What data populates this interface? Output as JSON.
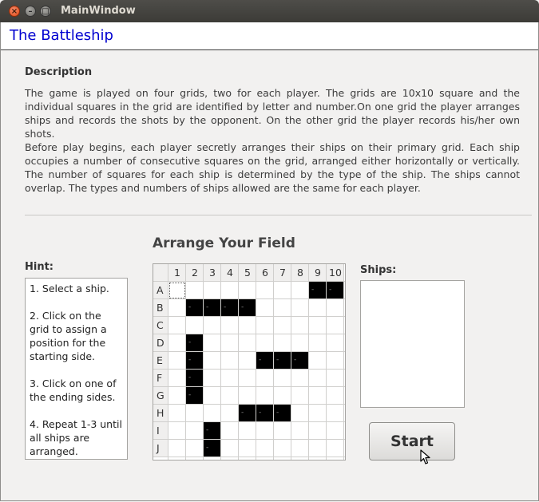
{
  "window": {
    "title": "MainWindow"
  },
  "app": {
    "title": "The Battleship"
  },
  "description": {
    "heading": "Description",
    "para1": "The game is played on four grids, two for each player. The grids are 10x10 square and the individual squares in the grid are identified by letter and number.On one grid the player arranges ships and records the shots by the opponent. On the other grid the player records his/her own shots.",
    "para2": "Before play begins, each player secretly arranges their ships on their primary grid. Each ship occupies a number of consecutive squares on the grid, arranged either horizontally or vertically. The number of squares for each ship is determined by the type of the ship. The ships cannot overlap. The types and numbers of ships allowed are the same for each player."
  },
  "field": {
    "heading": "Arrange Your Field"
  },
  "hint": {
    "label": "Hint:",
    "steps": [
      "1. Select a ship.",
      "2. Click on the grid to assign a position for the starting side.",
      "3. Click on one of the ending sides.",
      "4. Repeat 1-3 until all ships are arranged."
    ]
  },
  "ships": {
    "label": "Ships:"
  },
  "grid": {
    "columns": [
      "1",
      "2",
      "3",
      "4",
      "5",
      "6",
      "7",
      "8",
      "9",
      "10"
    ],
    "rows": [
      "A",
      "B",
      "C",
      "D",
      "E",
      "F",
      "G",
      "H",
      "I",
      "J"
    ],
    "ship_mark": "-",
    "selected_cell": [
      0,
      0
    ],
    "occupied": [
      [
        0,
        8
      ],
      [
        0,
        9
      ],
      [
        1,
        1
      ],
      [
        1,
        2
      ],
      [
        1,
        3
      ],
      [
        1,
        4
      ],
      [
        3,
        1
      ],
      [
        4,
        1
      ],
      [
        4,
        5
      ],
      [
        4,
        6
      ],
      [
        4,
        7
      ],
      [
        5,
        1
      ],
      [
        6,
        1
      ],
      [
        7,
        4
      ],
      [
        7,
        5
      ],
      [
        7,
        6
      ],
      [
        8,
        2
      ],
      [
        9,
        2
      ]
    ]
  },
  "start_button": {
    "label": "Start"
  },
  "colors": {
    "app_title": "#0000d0",
    "ship": "#000000",
    "titlebar": "#3c3b37"
  }
}
